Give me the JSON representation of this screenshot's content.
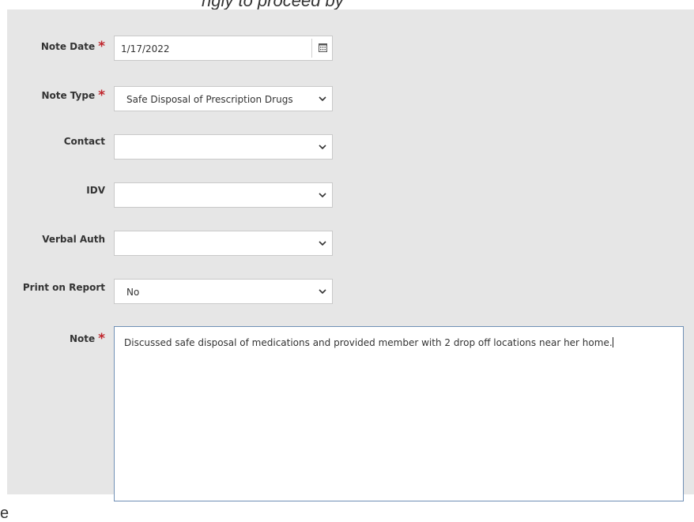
{
  "form": {
    "note_date": {
      "label": "Note Date",
      "required": true,
      "value": "1/17/2022",
      "icon": "calendar-icon"
    },
    "note_type": {
      "label": "Note Type",
      "required": true,
      "value": "Safe Disposal of Prescription Drugs"
    },
    "contact": {
      "label": "Contact",
      "required": false,
      "value": ""
    },
    "idv": {
      "label": "IDV",
      "required": false,
      "value": ""
    },
    "verbal_auth": {
      "label": "Verbal Auth",
      "required": false,
      "value": ""
    },
    "print_on_report": {
      "label": "Print on Report",
      "required": false,
      "value": "No"
    },
    "note": {
      "label": "Note",
      "required": true,
      "value": "Discussed safe disposal of medications and provided member with 2 drop off locations near her home."
    }
  },
  "required_marker": "*",
  "colors": {
    "panel": "#e6e6e6",
    "required": "#c0262d",
    "focus_border": "#6f8fb5"
  }
}
